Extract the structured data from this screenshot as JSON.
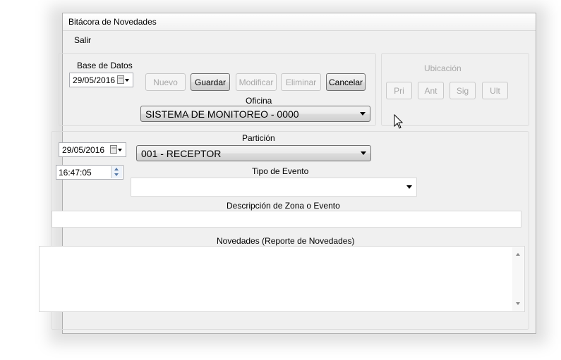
{
  "window": {
    "title": "Bitácora de Novedades"
  },
  "menu": {
    "exit_label": "Salir"
  },
  "database": {
    "group_label": "Base de Datos",
    "date_value": "29/05/2016",
    "buttons": {
      "new_label": "Nuevo",
      "save_label": "Guardar",
      "modify_label": "Modificar",
      "delete_label": "Eliminar",
      "cancel_label": "Cancelar"
    },
    "office_label": "Oficina",
    "office_value": "SISTEMA DE MONITOREO - 0000"
  },
  "location": {
    "group_label": "Ubicación",
    "first_label": "Pri",
    "prev_label": "Ant",
    "next_label": "Sig",
    "last_label": "Ult"
  },
  "event": {
    "date_value": "29/05/2016",
    "time_value": "16:47:05",
    "partition_label": "Partición",
    "partition_value": "001 - RECEPTOR",
    "event_type_label": "Tipo de Evento",
    "event_type_value": "",
    "zone_desc_label": "Descripción de Zona o Evento",
    "zone_desc_value": "",
    "report_label": "Novedades (Reporte de Novedades)",
    "report_value": ""
  },
  "colors": {
    "window_bg": "#f0f0f0",
    "disabled_text": "#a8a8a8",
    "border": "#707070"
  },
  "icons": [
    "calendar-icon",
    "chevron-down-icon",
    "spin-up-icon",
    "spin-down-icon",
    "mouse-cursor-icon"
  ]
}
